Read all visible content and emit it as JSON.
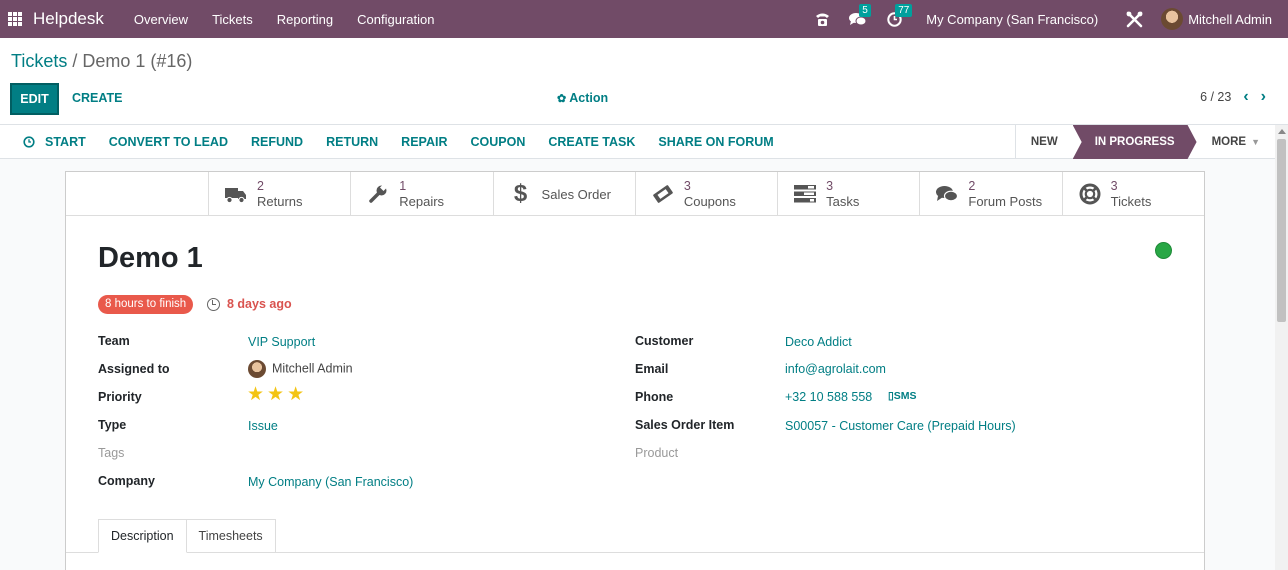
{
  "navbar": {
    "brand": "Helpdesk",
    "menu": [
      "Overview",
      "Tickets",
      "Reporting",
      "Configuration"
    ],
    "messages_count": "5",
    "activities_count": "77",
    "company": "My Company (San Francisco)",
    "user": "Mitchell Admin"
  },
  "breadcrumb": {
    "parent": "Tickets",
    "separator": " / ",
    "current": "Demo 1 (#16)"
  },
  "toolbar": {
    "edit": "EDIT",
    "create": "CREATE",
    "action": "Action"
  },
  "pager": {
    "value": "6 / 23"
  },
  "status_buttons": [
    "START",
    "CONVERT TO LEAD",
    "REFUND",
    "RETURN",
    "REPAIR",
    "COUPON",
    "CREATE TASK",
    "SHARE ON FORUM"
  ],
  "stages": {
    "new": "NEW",
    "in_progress": "IN PROGRESS",
    "more": "MORE"
  },
  "smart_buttons": [
    {
      "num": "2",
      "label": "Returns",
      "icon": "truck-icon"
    },
    {
      "num": "1",
      "label": "Repairs",
      "icon": "wrench-icon"
    },
    {
      "num": "",
      "label": "Sales Order",
      "icon": "dollar-icon"
    },
    {
      "num": "3",
      "label": "Coupons",
      "icon": "ticket-icon"
    },
    {
      "num": "3",
      "label": "Tasks",
      "icon": "tasks-icon"
    },
    {
      "num": "2",
      "label": "Forum Posts",
      "icon": "comments-icon"
    },
    {
      "num": "3",
      "label": "Tickets",
      "icon": "lifebuoy-icon"
    }
  ],
  "ticket": {
    "title": "Demo 1",
    "sla": "8 hours to finish",
    "age": "8 days ago",
    "priority_stars": 3,
    "kanban_state_color": "#28a745"
  },
  "fields_left": {
    "team_label": "Team",
    "team": "VIP Support",
    "assigned_label": "Assigned to",
    "assigned": "Mitchell Admin",
    "priority_label": "Priority",
    "type_label": "Type",
    "type": "Issue",
    "tags_label": "Tags",
    "company_label": "Company",
    "company": "My Company (San Francisco)"
  },
  "fields_right": {
    "customer_label": "Customer",
    "customer": "Deco Addict",
    "email_label": "Email",
    "email": "info@agrolait.com",
    "phone_label": "Phone",
    "phone": "+32 10 588 558",
    "sms": "SMS",
    "so_item_label": "Sales Order Item",
    "so_item": "S00057 - Customer Care (Prepaid Hours)",
    "product_label": "Product"
  },
  "tabs": [
    "Description",
    "Timesheets"
  ],
  "colors": {
    "brand": "#714B67",
    "accent": "#017e84",
    "badge": "#00A09D",
    "danger": "#e9594b"
  }
}
